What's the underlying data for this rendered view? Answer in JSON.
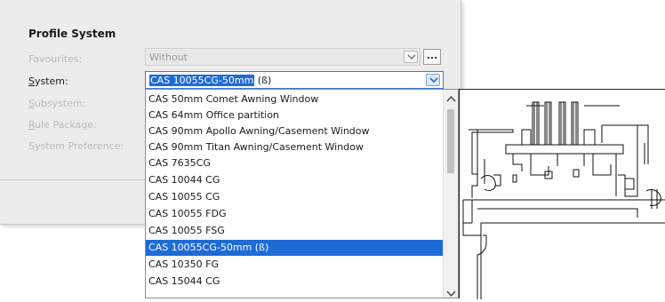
{
  "dialog": {
    "title": "Profile System",
    "labels": {
      "favourites": "Favourites:",
      "system": "System:",
      "subsystem": "Subsystem:",
      "rule_package": "Rule Package:",
      "system_preference": "System Preference:"
    },
    "favourites_value": "Without",
    "system_value_highlight": "CAS 10055CG-50mm",
    "system_value_rest": " (ß)",
    "ellipsis_label": "..."
  },
  "dropdown": {
    "items": [
      "CAS 50mm Comet Awning Window",
      "CAS 64mm Office partition",
      "CAS 90mm Apollo Awning/Casement Window",
      "CAS 90mm Titan Awning/Casement Window",
      "CAS 7635CG",
      "CAS 10044 CG",
      "CAS 10055 CG",
      "CAS 10055 FDG",
      "CAS 10055 FSG",
      "CAS 10055CG-50mm (ß)",
      "CAS 10350 FG",
      "CAS 15044 CG"
    ],
    "selected_index": 9
  },
  "icons": {
    "dropdown": "chevron-down-icon",
    "scroll_up": "scroll-up-arrow-icon",
    "scroll_down": "scroll-down-arrow-icon"
  },
  "colors": {
    "selection": "#1e6bd6",
    "panel": "#ececec"
  }
}
